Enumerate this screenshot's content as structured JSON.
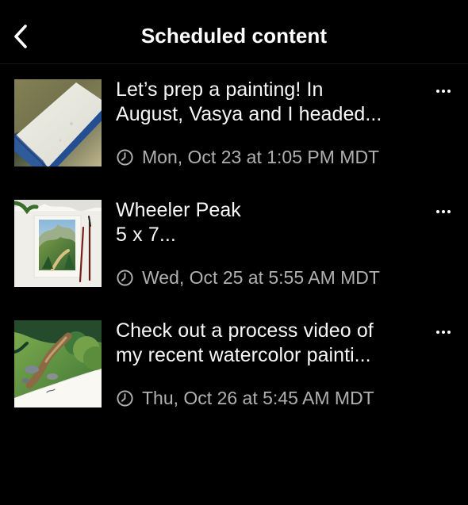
{
  "screen": {
    "title": "Scheduled content"
  },
  "navigation": {
    "back_icon": "chevron-left-icon"
  },
  "scheduled_posts": [
    {
      "caption_line_1": "Let’s prep a painting! In",
      "caption_line_2": "August, Vasya and I headed...",
      "schedule": "Mon, Oct 23 at 1:05 PM MDT",
      "thumbnail": "watercolor paper prep with blue tape",
      "more_icon": "more-horizontal-icon"
    },
    {
      "caption_line_1": "Wheeler Peak",
      "caption_line_2": "5 x 7...",
      "schedule": "Wed, Oct 25 at 5:55 AM MDT",
      "thumbnail": "small mountain watercolor painting with brushes",
      "more_icon": "more-horizontal-icon"
    },
    {
      "caption_line_1": "Check out a process video of",
      "caption_line_2": "my recent watercolor painti...",
      "schedule": "Thu, Oct 26 at 5:45 AM MDT",
      "thumbnail": "watercolor forest path painting",
      "more_icon": "more-horizontal-icon"
    }
  ],
  "colors": {
    "background": "#000000",
    "primary_text": "#f6f6f6",
    "secondary_text": "#b0b0b0"
  }
}
